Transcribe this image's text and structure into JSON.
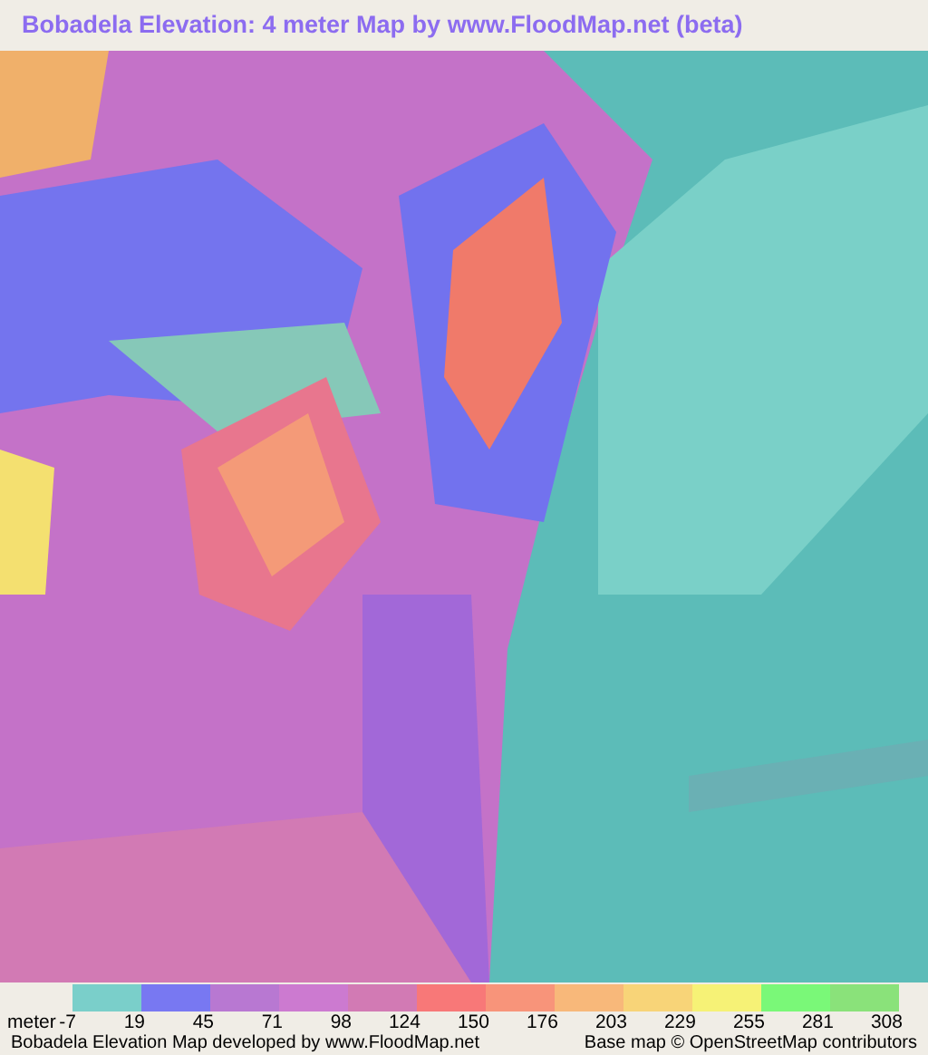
{
  "title": "Bobadela Elevation: 4 meter Map by www.FloodMap.net (beta)",
  "legend": {
    "unit": "meter",
    "swatches": [
      {
        "color": "#7acfca"
      },
      {
        "color": "#7878f2"
      },
      {
        "color": "#b878d2"
      },
      {
        "color": "#cc7ad0"
      },
      {
        "color": "#d27ab4"
      },
      {
        "color": "#f87878"
      },
      {
        "color": "#f8947a"
      },
      {
        "color": "#f8b87a"
      },
      {
        "color": "#f8d478"
      },
      {
        "color": "#f6f276"
      },
      {
        "color": "#7af878"
      },
      {
        "color": "#8ae27a"
      }
    ],
    "values": [
      "-7",
      "19",
      "45",
      "71",
      "98",
      "124",
      "150",
      "176",
      "203",
      "229",
      "255",
      "281",
      "308"
    ]
  },
  "footer": {
    "left": "Bobadela Elevation Map developed by www.FloodMap.net",
    "right": "Base map © OpenStreetMap contributors"
  }
}
